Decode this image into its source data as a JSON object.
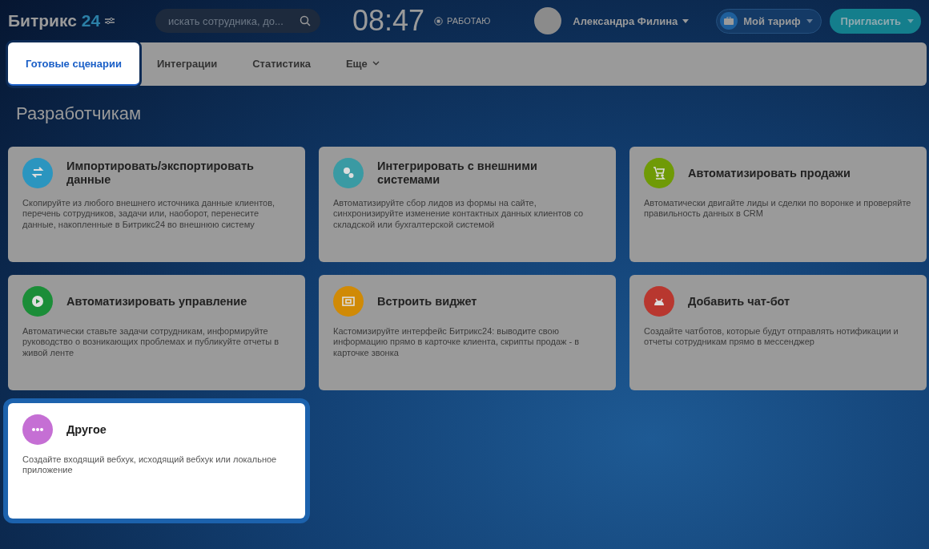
{
  "header": {
    "logo": {
      "name": "Битрикс",
      "number": "24"
    },
    "search": {
      "placeholder": "искать сотрудника, до..."
    },
    "clock": "08:47",
    "work_status": "РАБОТАЮ",
    "user": {
      "name": "Александра Филина"
    },
    "tariff_button": "Мой тариф",
    "invite_button": "Пригласить"
  },
  "tabs": [
    {
      "label": "Готовые сценарии",
      "selected": true
    },
    {
      "label": "Интеграции",
      "selected": false
    },
    {
      "label": "Статистика",
      "selected": false
    },
    {
      "label": "Еще",
      "selected": false,
      "kind": "dropdown"
    }
  ],
  "page_title": "Разработчикам",
  "cards": [
    {
      "title": "Импортировать/экспортировать данные",
      "description": "Скопируйте из любого внешнего источника данные клиентов, перечень сотрудников, задачи или, наоборот, перенесите данные, накопленные в Битрикс24 во внешнюю систему",
      "color": "#2b95bf",
      "highlighted": false
    },
    {
      "title": "Интегрировать с внешними системами",
      "description": "Автоматизируйте сбор лидов из формы на сайте, синхронизируйте изменение контактных данных клиентов со складской или бухгалтерской системой",
      "color": "#3a9aa3",
      "highlighted": false
    },
    {
      "title": "Автоматизировать продажи",
      "description": "Автоматически двигайте лиды и сделки по воронке и проверяйте правильность данных в CRM",
      "color": "#6f9a06",
      "highlighted": false
    },
    {
      "title": "Автоматизировать управление",
      "description": "Автоматически ставьте задачи сотрудникам, информируйте руководство о возникающих проблемах и публикуйте отчеты в живой ленте",
      "color": "#1b8d38",
      "highlighted": false
    },
    {
      "title": "Встроить виджет",
      "description": "Кастомизируйте интерфейс Битрикс24: выводите свою информацию прямо в карточке клиента, скрипты продаж - в карточке звонка",
      "color": "#d08a06",
      "highlighted": false
    },
    {
      "title": "Добавить чат-бот",
      "description": "Создайте чатботов, которые будут отправлять нотификации и отчеты сотрудникам прямо в мессенджер",
      "color": "#b8372f",
      "highlighted": false
    },
    {
      "title": "Другое",
      "description": "Создайте входящий вебхук, исходящий вебхук или локальное приложение",
      "color": "#c56fd4",
      "highlighted": true
    }
  ]
}
